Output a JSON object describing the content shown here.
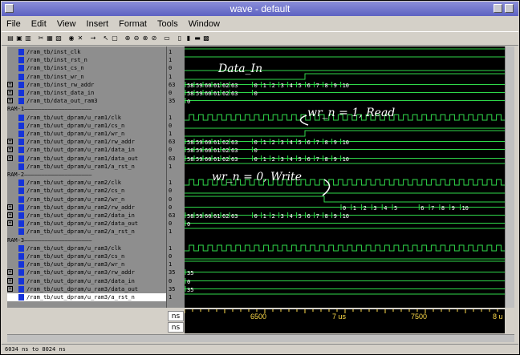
{
  "window": {
    "title": "wave - default"
  },
  "menu": [
    "File",
    "Edit",
    "View",
    "Insert",
    "Format",
    "Tools",
    "Window"
  ],
  "toolbar": {
    "icons": [
      "open-icon",
      "save-icon",
      "print-icon",
      "cut-icon",
      "copy-icon",
      "paste-icon",
      "find-icon",
      "delete-icon",
      "insert-cursor-icon",
      "select-icon",
      "zoom-mode-icon",
      "zoom-in-icon",
      "zoom-out-icon",
      "zoom-full-icon",
      "zoom-range-icon",
      "prev-cursor-icon",
      "add-cursor-icon",
      "next-edge-icon",
      "prev-edge-icon",
      "find-edge-icon"
    ]
  },
  "signals": [
    {
      "name": "/ram_tb/inst_clk",
      "value": "1",
      "bus": false
    },
    {
      "name": "/ram_tb/inst_rst_n",
      "value": "1",
      "bus": false
    },
    {
      "name": "/ram_tb/inst_cs_n",
      "value": "0",
      "bus": false
    },
    {
      "name": "/ram_tb/inst_wr_n",
      "value": "1",
      "bus": false
    },
    {
      "name": "/ram_tb/inst_rw_addr",
      "value": "63",
      "bus": true
    },
    {
      "name": "/ram_tb/inst_data_in",
      "value": "0",
      "bus": true
    },
    {
      "name": "/ram_tb/data_out_ram3",
      "value": "35",
      "bus": true
    },
    {
      "group": "RAM-1"
    },
    {
      "name": "/ram_tb/uut_dpram/u_ram1/clk",
      "value": "1",
      "bus": false
    },
    {
      "name": "/ram_tb/uut_dpram/u_ram1/cs_n",
      "value": "0",
      "bus": false
    },
    {
      "name": "/ram_tb/uut_dpram/u_ram1/wr_n",
      "value": "1",
      "bus": false
    },
    {
      "name": "/ram_tb/uut_dpram/u_ram1/rw_addr",
      "value": "63",
      "bus": true
    },
    {
      "name": "/ram_tb/uut_dpram/u_ram1/data_in",
      "value": "0",
      "bus": true
    },
    {
      "name": "/ram_tb/uut_dpram/u_ram1/data_out",
      "value": "63",
      "bus": true
    },
    {
      "name": "/ram_tb/uut_dpram/u_ram1/a_rst_n",
      "value": "1",
      "bus": false
    },
    {
      "group": "RAM-2"
    },
    {
      "name": "/ram_tb/uut_dpram/u_ram2/clk",
      "value": "1",
      "bus": false
    },
    {
      "name": "/ram_tb/uut_dpram/u_ram2/cs_n",
      "value": "0",
      "bus": false
    },
    {
      "name": "/ram_tb/uut_dpram/u_ram2/wr_n",
      "value": "0",
      "bus": false
    },
    {
      "name": "/ram_tb/uut_dpram/u_ram2/rw_addr",
      "value": "0",
      "bus": true
    },
    {
      "name": "/ram_tb/uut_dpram/u_ram2/data_in",
      "value": "63",
      "bus": true
    },
    {
      "name": "/ram_tb/uut_dpram/u_ram2/data_out",
      "value": "0",
      "bus": true
    },
    {
      "name": "/ram_tb/uut_dpram/u_ram2/a_rst_n",
      "value": "1",
      "bus": false
    },
    {
      "group": "RAM-3"
    },
    {
      "name": "/ram_tb/uut_dpram/u_ram3/clk",
      "value": "1",
      "bus": false
    },
    {
      "name": "/ram_tb/uut_dpram/u_ram3/cs_n",
      "value": "0",
      "bus": false
    },
    {
      "name": "/ram_tb/uut_dpram/u_ram3/wr_n",
      "value": "1",
      "bus": false
    },
    {
      "name": "/ram_tb/uut_dpram/u_ram3/rw_addr",
      "value": "35",
      "bus": true
    },
    {
      "name": "/ram_tb/uut_dpram/u_ram3/data_in",
      "value": "0",
      "bus": true
    },
    {
      "name": "/ram_tb/uut_dpram/u_ram3/data_out",
      "value": "35",
      "bus": true
    },
    {
      "name": "/ram_tb/uut_dpram/u_ram3/a_rst_n",
      "value": "1",
      "bus": false,
      "selected": true
    }
  ],
  "bus_labels": {
    "inst_rw_addr": [
      "58",
      "59",
      "60",
      "61",
      "62",
      "63",
      "0",
      "1",
      "2",
      "3",
      "4",
      "5",
      "6",
      "7",
      "8",
      "9",
      "10"
    ],
    "inst_data_in": [
      "58",
      "59",
      "60",
      "61",
      "62",
      "63",
      "0"
    ],
    "data_out_ram3": [
      "0"
    ],
    "ram1_rw_addr": [
      "58",
      "59",
      "60",
      "61",
      "62",
      "63",
      "0",
      "1",
      "2",
      "3",
      "4",
      "5",
      "6",
      "7",
      "8",
      "9",
      "10"
    ],
    "ram1_data_in": [
      "58",
      "59",
      "60",
      "61",
      "62",
      "63",
      "0"
    ],
    "ram1_data_out": [
      "58",
      "59",
      "60",
      "61",
      "62",
      "63",
      "0",
      "1",
      "2",
      "3",
      "4",
      "5",
      "6",
      "7",
      "8",
      "9",
      "10"
    ],
    "ram2_rw_addr": [
      "0",
      "1",
      "2",
      "3",
      "4",
      "5",
      "6",
      "7",
      "8",
      "9",
      "10"
    ],
    "ram2_data_in": [
      "58",
      "59",
      "60",
      "61",
      "62",
      "63",
      "0",
      "1",
      "2",
      "3",
      "4",
      "5",
      "6",
      "7",
      "8",
      "9",
      "10"
    ],
    "ram2_data_out": [
      "0"
    ],
    "ram3_rw_addr": [
      "35"
    ],
    "ram3_data_in": [
      "0"
    ],
    "ram3_data_out": [
      "35"
    ]
  },
  "annotations": {
    "data_in": "Data_In",
    "read": "wr_n  = 1, Read",
    "write": "wr_n  = 0, Write"
  },
  "timeline": {
    "unit": "ns",
    "unit2": "ns",
    "ticks": [
      "6500",
      "7 us",
      "7500",
      "8 u"
    ]
  },
  "status": "6034 ns to 8024 ns",
  "colors": {
    "wave": "#2fd94a",
    "bus": "#ffffff",
    "timeline_text": "#ffdc4a",
    "background": "#000000",
    "title_bar": "#6a6fcc"
  }
}
